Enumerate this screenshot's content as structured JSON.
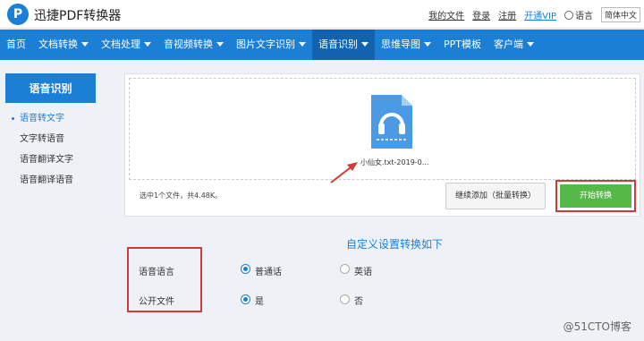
{
  "app": {
    "logo_letter": "P",
    "brand": "迅捷PDF转换器"
  },
  "toplinks": {
    "my_files": "我的文件",
    "login": "登录",
    "register": "注册",
    "vip": "开通VIP",
    "language_label": "语言",
    "language_value": "简体中文"
  },
  "nav": {
    "items": [
      {
        "label": "首页"
      },
      {
        "label": "文档转换"
      },
      {
        "label": "文档处理"
      },
      {
        "label": "音视频转换"
      },
      {
        "label": "图片文字识别"
      },
      {
        "label": "语音识别"
      },
      {
        "label": "思维导图"
      },
      {
        "label": "PPT模板"
      },
      {
        "label": "客户端"
      }
    ]
  },
  "sidebar": {
    "title": "语音识别",
    "items": [
      {
        "label": "语音转文字"
      },
      {
        "label": "文字转语音"
      },
      {
        "label": "语音翻译文字"
      },
      {
        "label": "语音翻译语音"
      }
    ]
  },
  "upload": {
    "filename": "小仙女.txt-2019-0...",
    "status": "选中1个文件，共4.48K。",
    "add_button": "继续添加（批量转换）",
    "start_button": "开始转换"
  },
  "settings": {
    "title": "自定义设置转换如下",
    "rows": [
      {
        "label": "语音语言",
        "options": [
          "普通话",
          "英语"
        ],
        "selected": 0
      },
      {
        "label": "公开文件",
        "options": [
          "是",
          "否"
        ],
        "selected": 0
      }
    ]
  },
  "watermark": "@51CTO博客",
  "colors": {
    "accent": "#1c7fd6",
    "nav_active": "#1163b0",
    "start_button": "#54b947",
    "highlight_box": "#d43a3a"
  },
  "icons": {
    "file": "headphones-file-icon",
    "language": "globe-icon"
  }
}
